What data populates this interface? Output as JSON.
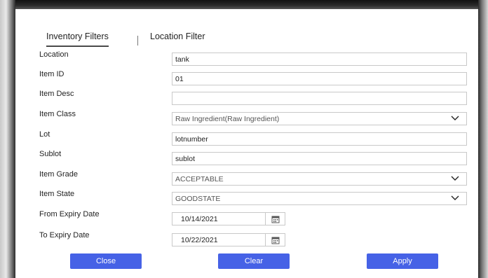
{
  "tabs": [
    {
      "label": "Inventory Filters",
      "active": true
    },
    {
      "label": "Location Filter",
      "active": false
    }
  ],
  "form": {
    "location": {
      "label": "Location",
      "value": "tank"
    },
    "item_id": {
      "label": "Item ID",
      "value": "01"
    },
    "item_desc": {
      "label": "Item Desc",
      "value": ""
    },
    "item_class": {
      "label": "Item Class",
      "value": "Raw Ingredient(Raw Ingredient)"
    },
    "lot": {
      "label": "Lot",
      "value": "lotnumber"
    },
    "sublot": {
      "label": "Sublot",
      "value": "sublot"
    },
    "item_grade": {
      "label": "Item Grade",
      "value": "ACCEPTABLE"
    },
    "item_state": {
      "label": "Item State",
      "value": "GOODSTATE"
    },
    "from_expiry": {
      "label": "From Expiry Date",
      "value": "10/14/2021"
    },
    "to_expiry": {
      "label": "To Expiry Date",
      "value": "10/22/2021"
    }
  },
  "buttons": {
    "close": "Close",
    "clear": "Clear",
    "apply": "Apply"
  },
  "colors": {
    "button": "#4662e6",
    "field_border": "#c9c9c9"
  }
}
